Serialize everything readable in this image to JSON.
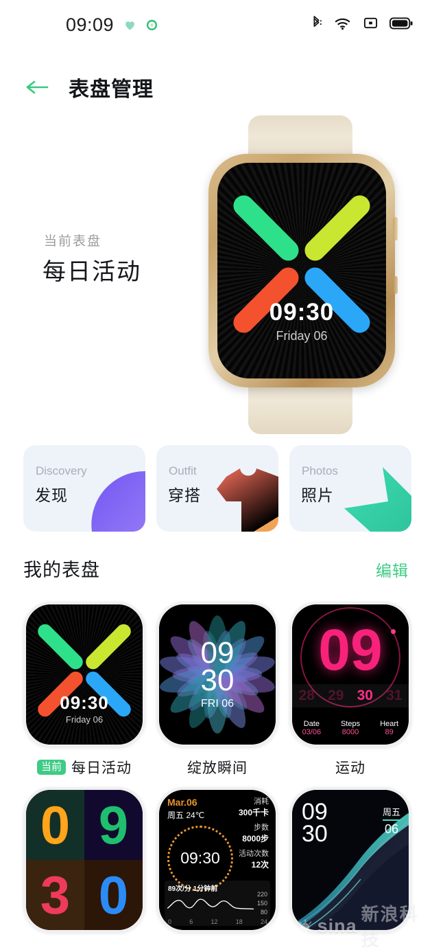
{
  "statusbar": {
    "time": "09:09",
    "icons_left": [
      "heart-icon",
      "green-circle-icon"
    ],
    "icons_right": [
      "bluetooth-icon",
      "wifi-icon",
      "screen-record-icon",
      "battery-icon"
    ]
  },
  "header": {
    "back_icon": "back-arrow-icon",
    "title": "表盘管理"
  },
  "hero": {
    "label": "当前表盘",
    "name": "每日活动",
    "watch_face": {
      "time": "09:30",
      "date": "Friday 06",
      "bar_colors": [
        "#2ee08a",
        "#c9e730",
        "#f4522e",
        "#2aa8f7"
      ]
    }
  },
  "categories": [
    {
      "en": "Discovery",
      "cn": "发现",
      "art": "leaf-shape",
      "color": "#7b5cf0"
    },
    {
      "en": "Outfit",
      "cn": "穿搭",
      "art": "shirt-shape",
      "color": "#f4775c"
    },
    {
      "en": "Photos",
      "cn": "照片",
      "art": "mountain-shape",
      "color": "#3ed2a8"
    }
  ],
  "my_faces": {
    "title": "我的表盘",
    "edit_label": "编辑",
    "current_badge": "当前",
    "items": [
      {
        "name": "每日活动",
        "current": true,
        "style": "cross",
        "time": "09:30",
        "date": "Friday 06"
      },
      {
        "name": "绽放瞬间",
        "current": false,
        "style": "flower",
        "hour": "09",
        "minute": "30",
        "date": "FRI 06"
      },
      {
        "name": "运动",
        "current": false,
        "style": "sport",
        "hour": "09",
        "strip": [
          "28",
          "29",
          "30",
          "31"
        ],
        "strip_active": "30",
        "stats": [
          {
            "key": "Date",
            "value": "03/06"
          },
          {
            "key": "Steps",
            "value": "8000"
          },
          {
            "key": "Heart",
            "value": "89"
          }
        ]
      },
      {
        "name": "",
        "current": false,
        "style": "digits",
        "digits": [
          "0",
          "9",
          "3",
          "0"
        ],
        "digit_colors": [
          "#ffa41b",
          "#1fbf6e",
          "#ef3b5b",
          "#2b8cf7"
        ],
        "quad_bg": [
          "#123027",
          "#120a2e",
          "#3a2410",
          "#2c1608"
        ]
      },
      {
        "name": "",
        "current": false,
        "style": "data",
        "date": "Mar.06",
        "weekday_temp": "周五 24℃",
        "time": "09:30",
        "metrics": [
          {
            "key": "消耗",
            "value": "300千卡"
          },
          {
            "key": "步数",
            "value": "8000步"
          },
          {
            "key": "活动次数",
            "value": "12次"
          }
        ],
        "hr_label": "89次/分  1分钟前",
        "y_ticks": [
          "220",
          "150",
          "80"
        ],
        "x_ticks": [
          "0",
          "6",
          "12",
          "18",
          "24"
        ]
      },
      {
        "name": "",
        "current": false,
        "style": "wave",
        "hour": "09",
        "minute": "30",
        "weekday": "周五",
        "day": "06"
      }
    ]
  },
  "watermark": {
    "brand": "sina",
    "cn": "新浪科技"
  }
}
